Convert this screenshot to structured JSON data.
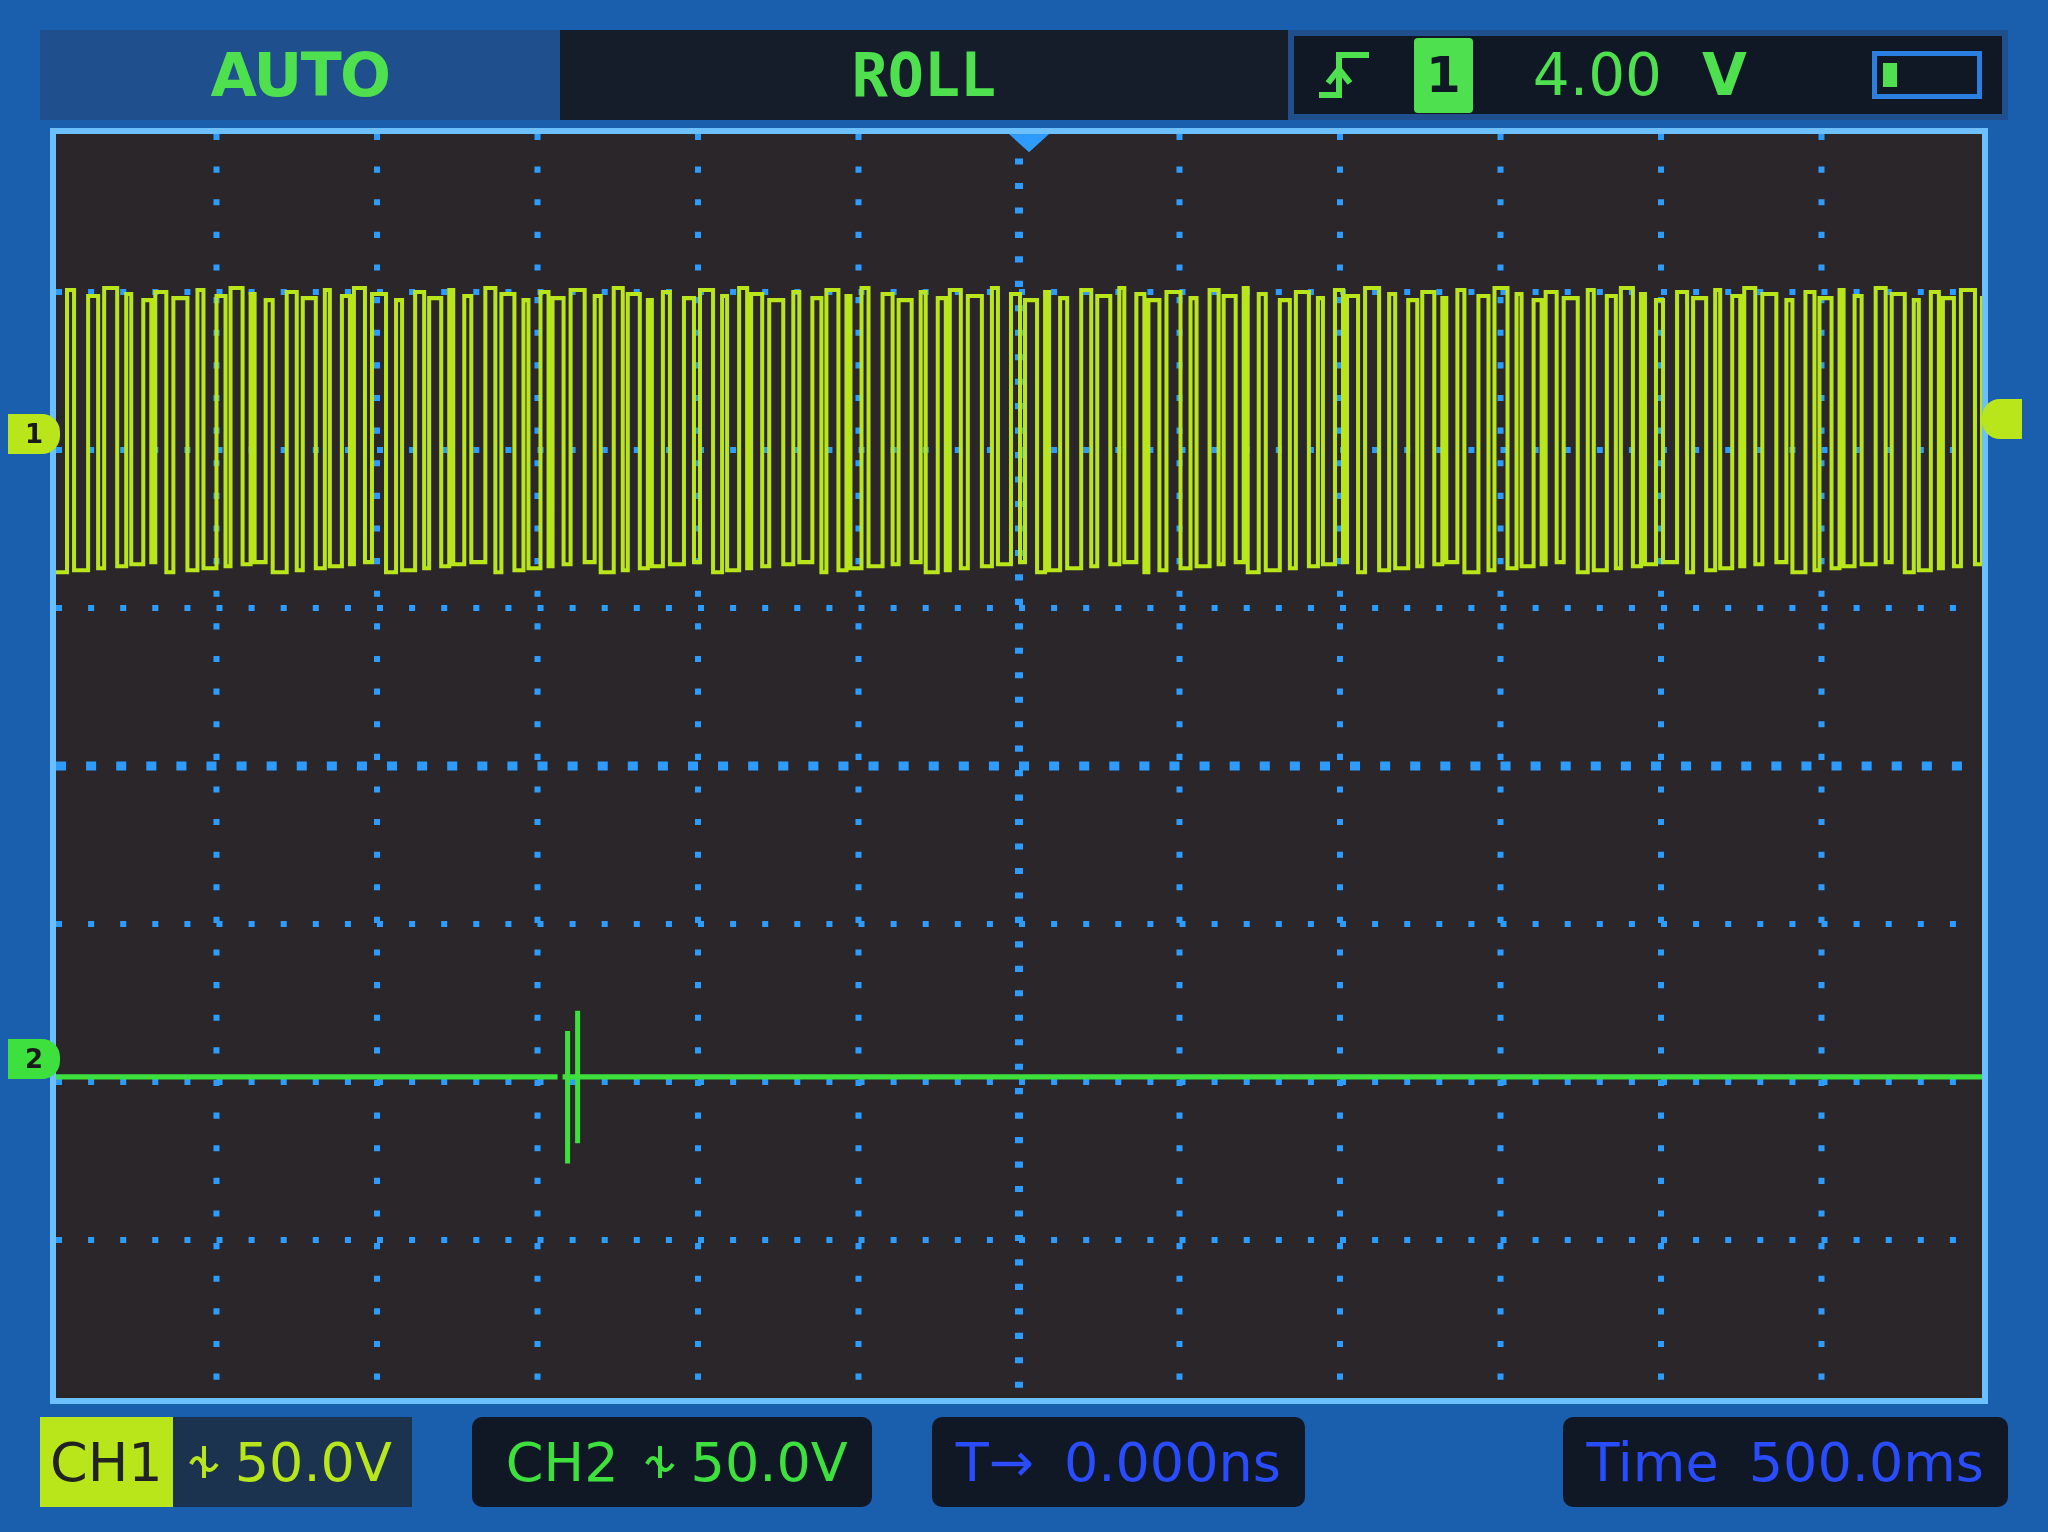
{
  "top_bar": {
    "mode": "AUTO",
    "state": "ROLL",
    "trigger": {
      "source": "1",
      "level": "4.00",
      "unit": "V"
    }
  },
  "plot": {
    "channel_markers": [
      {
        "label": "1",
        "color": "#b8e61a"
      },
      {
        "label": "2",
        "color": "#3ee03e"
      }
    ]
  },
  "bottom_bar": {
    "channels": [
      {
        "label": "CH1",
        "scale": "50.0V",
        "selected": true
      },
      {
        "label": "CH2",
        "scale": "50.0V",
        "selected": false
      }
    ],
    "trigger_offset": {
      "label": "T→",
      "value": "0.000ns"
    },
    "timebase": {
      "label": "Time",
      "value": "500.0ms"
    }
  }
}
